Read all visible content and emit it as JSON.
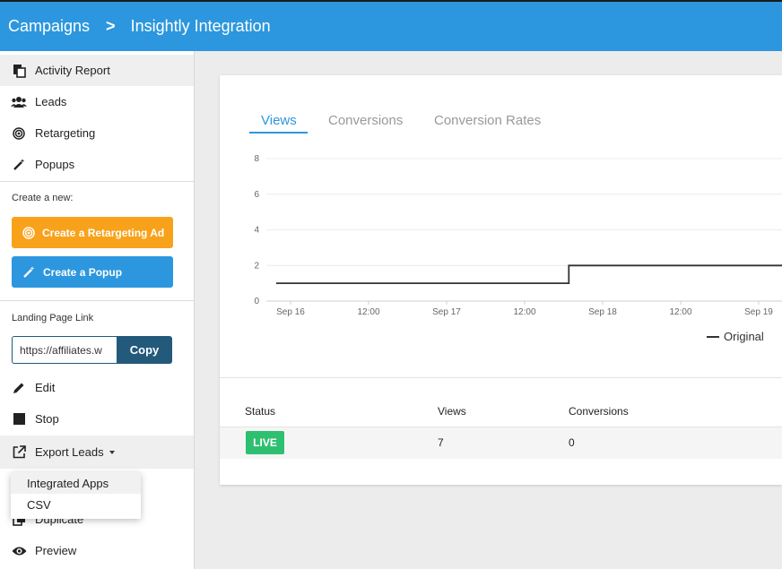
{
  "breadcrumb": {
    "root": "Campaigns",
    "separator": ">",
    "current": "Insightly Integration"
  },
  "sidebar": {
    "nav": [
      {
        "label": "Activity Report",
        "icon": "report-icon"
      },
      {
        "label": "Leads",
        "icon": "users-icon"
      },
      {
        "label": "Retargeting",
        "icon": "target-icon"
      },
      {
        "label": "Popups",
        "icon": "magic-wand-icon"
      }
    ],
    "create_label": "Create a new:",
    "create_retargeting": "Create a Retargeting Ad",
    "create_popup": "Create a Popup",
    "landing_label": "Landing Page Link",
    "landing_value": "https://affiliates.w",
    "copy_label": "Copy",
    "actions": {
      "edit": "Edit",
      "stop": "Stop",
      "export": "Export Leads",
      "duplicate": "Duplicate",
      "preview": "Preview"
    },
    "export_menu": [
      "Integrated Apps",
      "CSV"
    ]
  },
  "tabs": [
    "Views",
    "Conversions",
    "Conversion Rates"
  ],
  "chart_data": {
    "type": "line",
    "x_ticks": [
      "Sep 16",
      "12:00",
      "Sep 17",
      "12:00",
      "Sep 18",
      "12:00",
      "Sep 19"
    ],
    "y_ticks": [
      "0",
      "2",
      "4",
      "6",
      "8"
    ],
    "ylim": [
      0,
      8
    ],
    "series": [
      {
        "name": "Original",
        "color": "#333333",
        "step": true,
        "points": [
          [
            "Sep 16 00:00",
            1
          ],
          [
            "Sep 17 21:00",
            1
          ],
          [
            "Sep 17 21:00",
            2
          ],
          [
            "Sep 19 15:00",
            2
          ]
        ]
      }
    ],
    "legend_position": "bottom-right",
    "grid": true
  },
  "table": {
    "headers": [
      "Status",
      "Views",
      "Conversions"
    ],
    "rows": [
      {
        "status": "LIVE",
        "views": "7",
        "conversions": "0"
      }
    ],
    "status_color": "#2fbf71"
  }
}
